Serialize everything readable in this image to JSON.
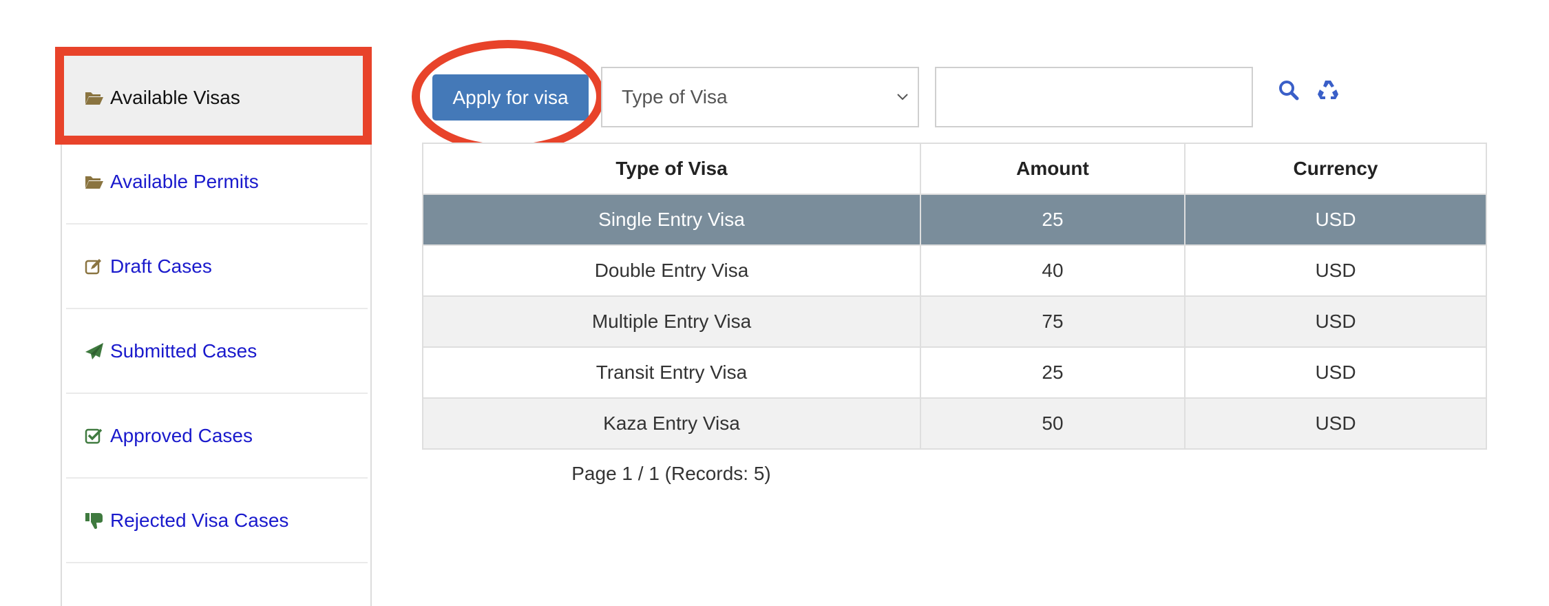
{
  "sidebar": {
    "items": [
      {
        "label": "Available Visas",
        "icon": "folder-open-icon",
        "active": true
      },
      {
        "label": "Available Permits",
        "icon": "folder-open-icon",
        "active": false
      },
      {
        "label": "Draft Cases",
        "icon": "edit-icon",
        "active": false
      },
      {
        "label": "Submitted Cases",
        "icon": "paper-plane-icon",
        "active": false
      },
      {
        "label": "Approved Cases",
        "icon": "check-square-icon",
        "active": false
      },
      {
        "label": "Rejected Visa Cases",
        "icon": "thumbs-down-icon",
        "active": false
      }
    ]
  },
  "toolbar": {
    "apply_label": "Apply for visa",
    "select_value": "Type of Visa",
    "search_value": "",
    "search_icon": "search-icon",
    "reset_icon": "recycle-icon"
  },
  "table": {
    "columns": [
      "Type of Visa",
      "Amount",
      "Currency"
    ],
    "rows": [
      {
        "type": "Single Entry Visa",
        "amount": "25",
        "currency": "USD",
        "selected": true
      },
      {
        "type": "Double Entry Visa",
        "amount": "40",
        "currency": "USD",
        "selected": false
      },
      {
        "type": "Multiple Entry Visa",
        "amount": "75",
        "currency": "USD",
        "selected": false
      },
      {
        "type": "Transit Entry Visa",
        "amount": "25",
        "currency": "USD",
        "selected": false
      },
      {
        "type": "Kaza Entry Visa",
        "amount": "50",
        "currency": "USD",
        "selected": false
      }
    ]
  },
  "pagination": {
    "text": "Page 1 / 1 (Records: 5)"
  },
  "colors": {
    "accent": "#4479b8",
    "annotation": "#e8432a",
    "selected_row": "#7a8d9b",
    "link": "#1a1acc",
    "icon_brown": "#8a7440",
    "icon_green": "#3f7a3f",
    "icon_blue": "#3a5fc8"
  }
}
